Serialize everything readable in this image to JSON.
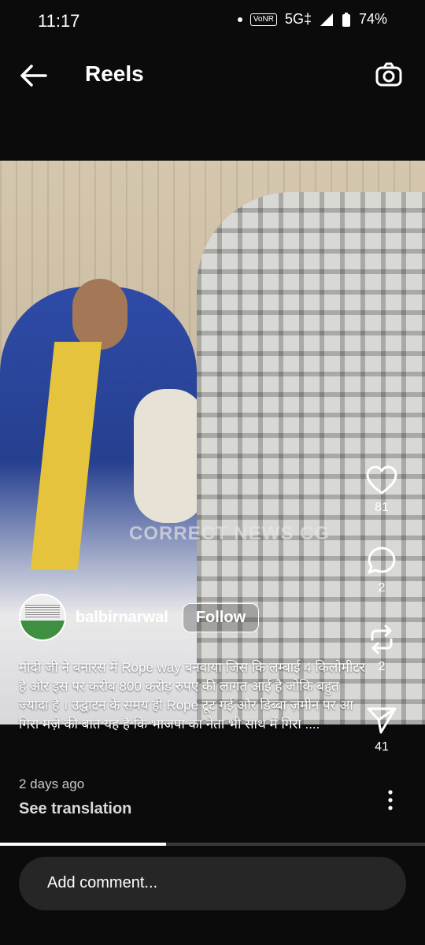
{
  "status": {
    "time": "11:17",
    "network": "5G‡",
    "vonr": "VoNR",
    "battery": "74%"
  },
  "app_bar": {
    "title": "Reels",
    "back_icon": "arrow-left-icon",
    "camera_icon": "camera-icon"
  },
  "video": {
    "watermark": "CORRECT NEWS CG"
  },
  "actions": {
    "likes": "81",
    "comments": "2",
    "reposts": "2",
    "shares": "41"
  },
  "author": {
    "username": "balbirnarwal",
    "follow_label": "Follow"
  },
  "caption": {
    "text": "मोदी जी ने बनारस में Rope way बनवाया जिस कि लम्बाई 4 किलोमीटर है और इस पर करीब 800 करोड़ रुपए की लागत आई है जोकि बहुत ज्यादा है । उद्घाटन के समय ही Rope टूट गई और डिब्बा ज़मीन पर आ गिरा मज़े की बात यह है कि भाजपा का नेता भी साथ में गिरा ....",
    "timestamp": "2 days ago",
    "translate_label": "See translation"
  },
  "progress": {
    "fraction": 0.39
  },
  "comment": {
    "placeholder": "Add comment..."
  }
}
